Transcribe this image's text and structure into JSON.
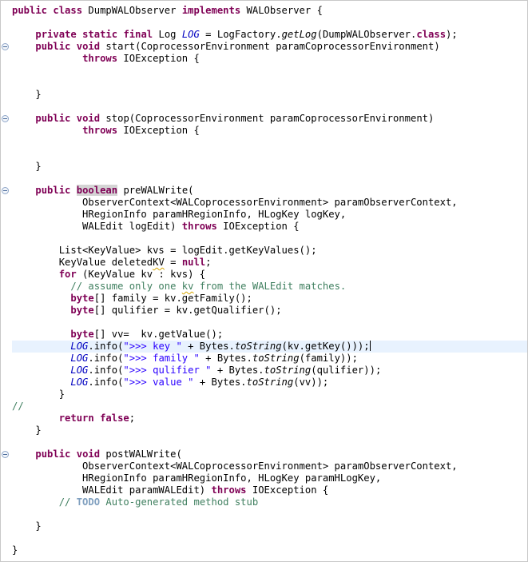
{
  "editor": {
    "lines": [
      [
        {
          "t": "public",
          "c": "k"
        },
        {
          "t": " "
        },
        {
          "t": "class",
          "c": "k"
        },
        {
          "t": " DumpWALObserver "
        },
        {
          "t": "implements",
          "c": "k"
        },
        {
          "t": " WALObserver {"
        }
      ],
      [],
      [
        {
          "t": "    "
        },
        {
          "t": "private",
          "c": "k"
        },
        {
          "t": " "
        },
        {
          "t": "static",
          "c": "k"
        },
        {
          "t": " "
        },
        {
          "t": "final",
          "c": "k"
        },
        {
          "t": " Log "
        },
        {
          "t": "LOG",
          "c": "f"
        },
        {
          "t": " = LogFactory."
        },
        {
          "t": "getLog",
          "c": "m"
        },
        {
          "t": "(DumpWALObserver."
        },
        {
          "t": "class",
          "c": "k"
        },
        {
          "t": ");"
        }
      ],
      [
        {
          "t": "    "
        },
        {
          "t": "public",
          "c": "k"
        },
        {
          "t": " "
        },
        {
          "t": "void",
          "c": "k"
        },
        {
          "t": " start(CoprocessorEnvironment paramCoprocessorEnvironment)"
        }
      ],
      [
        {
          "t": "            "
        },
        {
          "t": "throws",
          "c": "k"
        },
        {
          "t": " IOException {"
        }
      ],
      [],
      [],
      [
        {
          "t": "    }"
        }
      ],
      [],
      [
        {
          "t": "    "
        },
        {
          "t": "public",
          "c": "k"
        },
        {
          "t": " "
        },
        {
          "t": "void",
          "c": "k"
        },
        {
          "t": " stop(CoprocessorEnvironment paramCoprocessorEnvironment)"
        }
      ],
      [
        {
          "t": "            "
        },
        {
          "t": "throws",
          "c": "k"
        },
        {
          "t": " IOException {"
        }
      ],
      [],
      [],
      [
        {
          "t": "    }"
        }
      ],
      [],
      [
        {
          "t": "    "
        },
        {
          "t": "public",
          "c": "k"
        },
        {
          "t": " "
        },
        {
          "t": "boolean",
          "c": "k hl"
        },
        {
          "t": " preWALWrite("
        }
      ],
      [
        {
          "t": "            ObserverContext<WALCoprocessorEnvironment> paramObserverContext,"
        }
      ],
      [
        {
          "t": "            HRegionInfo paramHRegionInfo, HLogKey logKey,"
        }
      ],
      [
        {
          "t": "            WALEdit logEdit) "
        },
        {
          "t": "throws",
          "c": "k"
        },
        {
          "t": " IOException {"
        }
      ],
      [],
      [
        {
          "t": "        List<KeyValue> kvs = logEdit.getKeyValues();"
        }
      ],
      [
        {
          "t": "        KeyValue deleted"
        },
        {
          "t": "KV",
          "c": "sq"
        },
        {
          "t": " = "
        },
        {
          "t": "null",
          "c": "k"
        },
        {
          "t": ";"
        }
      ],
      [
        {
          "t": "        "
        },
        {
          "t": "for",
          "c": "k"
        },
        {
          "t": " (KeyValue kv : kvs) {"
        }
      ],
      [
        {
          "t": "          "
        },
        {
          "t": "// assume only one ",
          "c": "c"
        },
        {
          "t": "kv",
          "c": "c sq"
        },
        {
          "t": " from the WALEdit matches.",
          "c": "c"
        }
      ],
      [
        {
          "t": "          "
        },
        {
          "t": "byte",
          "c": "k"
        },
        {
          "t": "[] family = kv.getFamily();"
        }
      ],
      [
        {
          "t": "          "
        },
        {
          "t": "byte",
          "c": "k"
        },
        {
          "t": "[] qulifier = kv.getQualifier();"
        }
      ],
      [],
      [
        {
          "t": "          "
        },
        {
          "t": "byte",
          "c": "k"
        },
        {
          "t": "[] vv=  kv.getValue();"
        }
      ],
      [
        {
          "t": "          "
        },
        {
          "t": "LOG",
          "c": "f"
        },
        {
          "t": ".info("
        },
        {
          "t": "\">>> key \"",
          "c": "s"
        },
        {
          "t": " + Bytes."
        },
        {
          "t": "toString",
          "c": "m"
        },
        {
          "t": "(kv.getKey()));"
        }
      ],
      [
        {
          "t": "          "
        },
        {
          "t": "LOG",
          "c": "f"
        },
        {
          "t": ".info("
        },
        {
          "t": "\">>> family \"",
          "c": "s"
        },
        {
          "t": " + Bytes."
        },
        {
          "t": "toString",
          "c": "m"
        },
        {
          "t": "(family));"
        }
      ],
      [
        {
          "t": "          "
        },
        {
          "t": "LOG",
          "c": "f"
        },
        {
          "t": ".info("
        },
        {
          "t": "\">>> qulifier \"",
          "c": "s"
        },
        {
          "t": " + Bytes."
        },
        {
          "t": "toString",
          "c": "m"
        },
        {
          "t": "(qulifier));"
        }
      ],
      [
        {
          "t": "          "
        },
        {
          "t": "LOG",
          "c": "f"
        },
        {
          "t": ".info("
        },
        {
          "t": "\">>> value \"",
          "c": "s"
        },
        {
          "t": " + Bytes."
        },
        {
          "t": "toString",
          "c": "m"
        },
        {
          "t": "(vv));"
        }
      ],
      [
        {
          "t": "        }"
        }
      ],
      [
        {
          "t": "//",
          "c": "c"
        }
      ],
      [
        {
          "t": "        "
        },
        {
          "t": "return",
          "c": "k"
        },
        {
          "t": " "
        },
        {
          "t": "false",
          "c": "k"
        },
        {
          "t": ";"
        }
      ],
      [
        {
          "t": "    }"
        }
      ],
      [],
      [
        {
          "t": "    "
        },
        {
          "t": "public",
          "c": "k"
        },
        {
          "t": " "
        },
        {
          "t": "void",
          "c": "k"
        },
        {
          "t": " postWALWrite("
        }
      ],
      [
        {
          "t": "            ObserverContext<WALCoprocessorEnvironment> paramObserverContext,"
        }
      ],
      [
        {
          "t": "            HRegionInfo paramHRegionInfo, HLogKey paramHLogKey,"
        }
      ],
      [
        {
          "t": "            WALEdit paramWALEdit) "
        },
        {
          "t": "throws",
          "c": "k"
        },
        {
          "t": " IOException {"
        }
      ],
      [
        {
          "t": "        "
        },
        {
          "t": "// ",
          "c": "c"
        },
        {
          "t": "TODO",
          "c": "td"
        },
        {
          "t": " Auto-generated method stub",
          "c": "c"
        }
      ],
      [],
      [
        {
          "t": "    }"
        }
      ],
      [],
      [
        {
          "t": "}"
        }
      ]
    ],
    "current_line": 28,
    "caret_after_line": 28,
    "folds": [
      3,
      9,
      15,
      37
    ]
  }
}
